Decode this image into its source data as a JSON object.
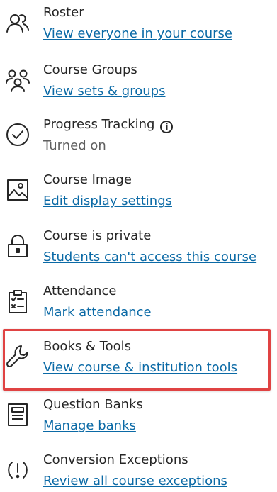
{
  "items": [
    {
      "title": "Roster",
      "sub": "View everyone in your course",
      "icon": "roster-icon"
    },
    {
      "title": "Course Groups",
      "sub": "View sets & groups",
      "icon": "groups-icon"
    },
    {
      "title": "Progress Tracking",
      "sub": "Turned on",
      "icon": "check-circle-icon"
    },
    {
      "title": "Course Image",
      "sub": "Edit display settings",
      "icon": "image-icon"
    },
    {
      "title": "Course is private",
      "sub": "Students can't access this course",
      "icon": "lock-icon"
    },
    {
      "title": "Attendance",
      "sub": "Mark attendance",
      "icon": "clipboard-icon"
    },
    {
      "title": "Books & Tools",
      "sub": "View course & institution tools",
      "icon": "wrench-icon"
    },
    {
      "title": "Question Banks",
      "sub": "Manage banks",
      "icon": "question-bank-icon"
    },
    {
      "title": "Conversion Exceptions",
      "sub": "Review all course exceptions",
      "icon": "exception-icon"
    }
  ],
  "info_glyph": "i",
  "colors": {
    "link": "#0b6aa6",
    "highlight": "#e04343",
    "text": "#262626"
  }
}
